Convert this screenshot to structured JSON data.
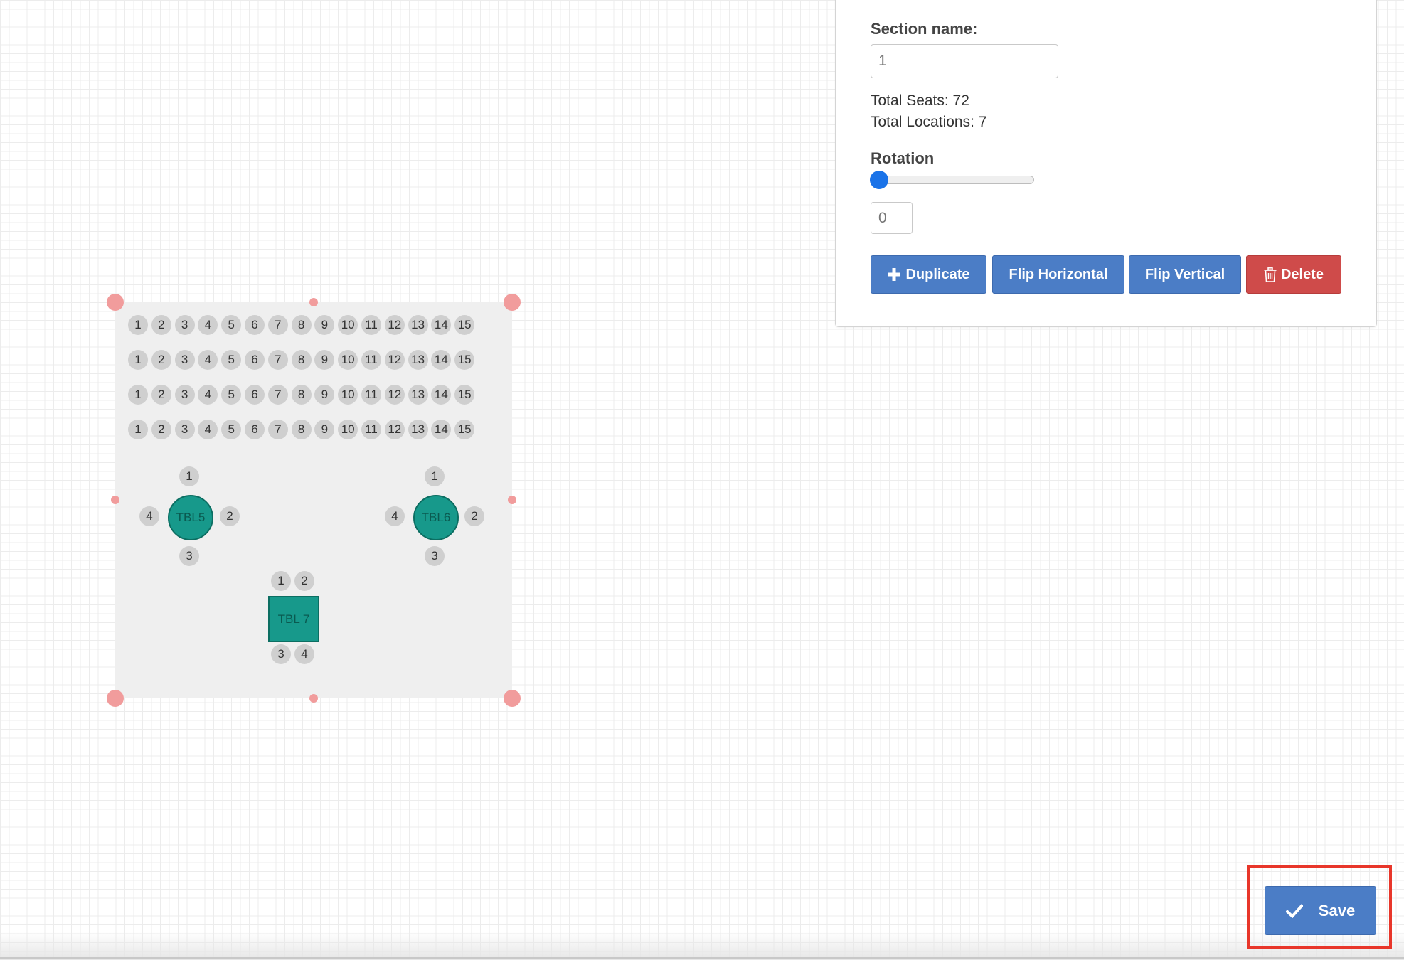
{
  "panel": {
    "section_name_label": "Section name:",
    "section_name_value": "1",
    "total_seats": "Total Seats: 72",
    "total_locations": "Total Locations: 7",
    "rotation_label": "Rotation",
    "rotation_value": "0",
    "rotation_slider_fraction": 0,
    "buttons": {
      "duplicate": "Duplicate",
      "flip_horizontal": "Flip Horizontal",
      "flip_vertical": "Flip Vertical",
      "delete": "Delete"
    }
  },
  "section": {
    "rows": 4,
    "seats_per_row": [
      "1",
      "2",
      "3",
      "4",
      "5",
      "6",
      "7",
      "8",
      "9",
      "10",
      "11",
      "12",
      "13",
      "14",
      "15"
    ],
    "tables": {
      "tbl5": {
        "label": "TBL5",
        "seats": [
          "1",
          "2",
          "3",
          "4"
        ]
      },
      "tbl6": {
        "label": "TBL6",
        "seats": [
          "1",
          "2",
          "3",
          "4"
        ]
      },
      "tbl7": {
        "label": "TBL 7",
        "seats": [
          "1",
          "2",
          "3",
          "4"
        ]
      }
    }
  },
  "save": {
    "label": "Save"
  },
  "colors": {
    "primary": "#4b7dc6",
    "danger": "#cf4b4a",
    "table": "#17998b",
    "handle": "#f19c9c",
    "highlight": "#e8362a",
    "slider": "#1a73e8"
  },
  "icons": {
    "duplicate": "plus-icon",
    "delete": "trash-icon",
    "save": "checkmark-icon"
  }
}
